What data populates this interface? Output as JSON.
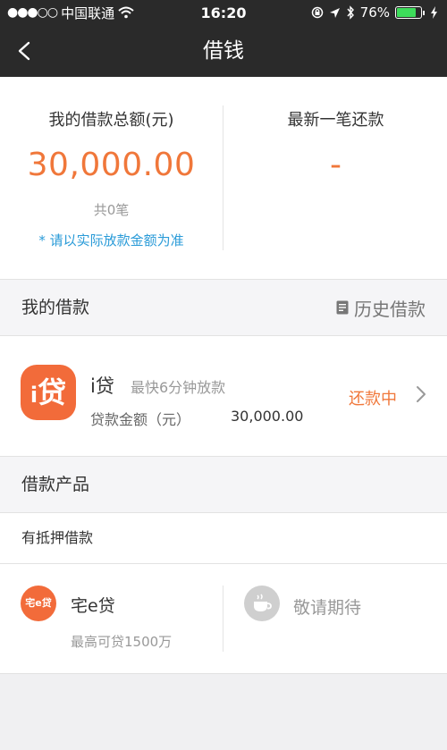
{
  "status_bar": {
    "signal_dots": "●●●○○",
    "carrier": "中国联通",
    "time": "16:20",
    "battery_percent": "76%",
    "battery_level": 0.76,
    "accent": "#3ddc5a"
  },
  "nav": {
    "title": "借钱",
    "back_icon": "chevron-left-icon"
  },
  "summary": {
    "left_label": "我的借款总额(元)",
    "total_amount": "30,000.00",
    "count_text": "共0笔",
    "note": "* 请以实际放款金额为准",
    "right_label": "最新一笔还款",
    "latest_repayment": "-"
  },
  "my_loans": {
    "title": "我的借款",
    "history_label": "历史借款",
    "history_icon": "document-icon"
  },
  "loan": {
    "logo_text": "贷",
    "logo_prefix": "i",
    "name": "i贷",
    "tag": "最快6分钟放款",
    "amount_label": "贷款金额（元）",
    "amount": "30,000.00",
    "status": "还款中",
    "brand_color": "#f26b3a",
    "status_color": "#f0773a"
  },
  "products_section": {
    "title": "借款产品",
    "subcategory": "有抵押借款"
  },
  "products": [
    {
      "logo_text": "宅e贷",
      "name": "宅e贷",
      "subtitle": "最高可贷1500万"
    },
    {
      "icon": "coffee-cup-icon",
      "name": "敬请期待"
    }
  ]
}
